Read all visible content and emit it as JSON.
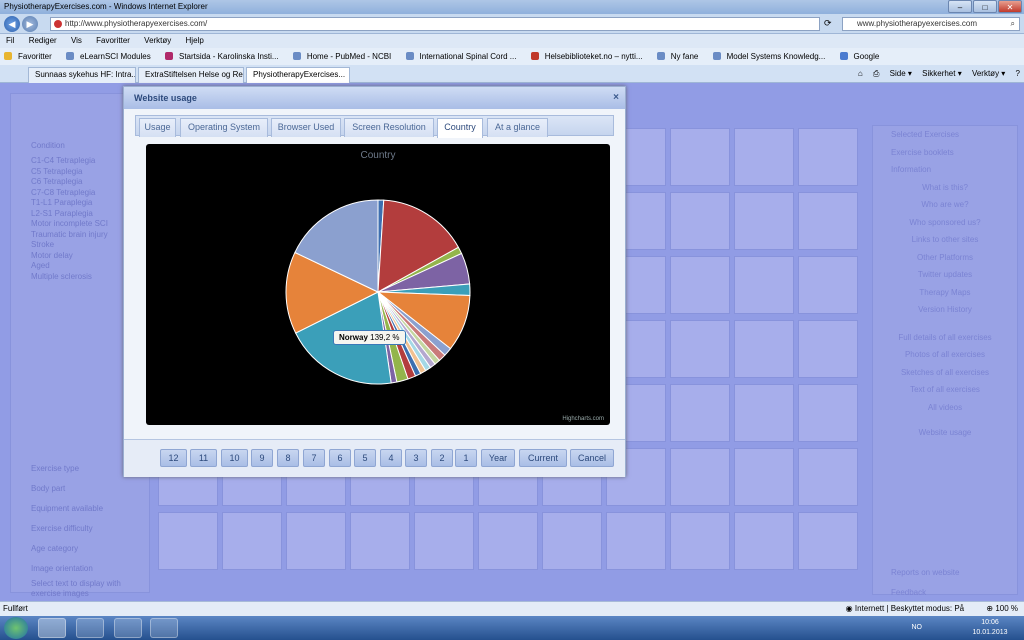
{
  "window": {
    "title": "PhysiotherapyExercises.com - Windows Internet Explorer",
    "address": "http://www.physiotherapyexercises.com/",
    "search_placeholder": "www.physiotherapyexercises.com"
  },
  "menu": [
    "Fil",
    "Rediger",
    "Vis",
    "Favoritter",
    "Verktøy",
    "Hjelp"
  ],
  "favorites": [
    "Favoritter",
    "eLearnSCI Modules",
    "Startsida - Karolinska Insti...",
    "Home - PubMed - NCBI",
    "International Spinal Cord ...",
    "Helsebiblioteket.no – nytti...",
    "Ny fane",
    "Model Systems Knowledg...",
    "Google"
  ],
  "tabs": [
    "Sunnaas sykehus HF: Intra...",
    "ExtraStiftelsen Helse og Re...",
    "PhysiotherapyExercises..."
  ],
  "command_bar": [
    "Side ▾",
    "Sikkerhet ▾",
    "Verktøy ▾"
  ],
  "left_panel": {
    "title": "Condition",
    "items": [
      "C1-C4 Tetraplegia",
      "C5 Tetraplegia",
      "C6 Tetraplegia",
      "C7-C8 Tetraplegia",
      "T1-L1 Paraplegia",
      "L2-S1 Paraplegia",
      "Motor incomplete SCI",
      "Traumatic brain injury",
      "Stroke",
      "Motor delay",
      "Aged",
      "Multiple sclerosis"
    ],
    "sections": [
      "Exercise type",
      "Body part",
      "Equipment available",
      "Exercise difficulty",
      "Age category",
      "Image orientation",
      "Select text to display with exercise images"
    ]
  },
  "right_panel": {
    "sections": [
      "Selected Exercises",
      "Exercise booklets",
      "Information"
    ],
    "links": [
      "What is this?",
      "Who are we?",
      "Who sponsored us?",
      "Links to other sites",
      "Other Platforms",
      "Twitter updates",
      "Therapy Maps",
      "Version History"
    ],
    "links2": [
      "Full details of all exercises",
      "Photos of all exercises",
      "Sketches of all exercises",
      "Text of all exercises",
      "All videos"
    ],
    "usage": "Website usage",
    "bottom": [
      "Reports on website",
      "Feedback"
    ]
  },
  "dialog": {
    "title": "Website usage",
    "close": "×",
    "tabs": [
      "Usage",
      "Operating System",
      "Browser Used",
      "Screen Resolution",
      "Country",
      "At a glance"
    ],
    "active_tab": "Country",
    "buttons": [
      "12",
      "11",
      "10",
      "9",
      "8",
      "7",
      "6",
      "5",
      "4",
      "3",
      "2",
      "1",
      "Year",
      "Current",
      "Cancel"
    ]
  },
  "tooltip": {
    "name": "Norway",
    "value": "139,2 %"
  },
  "credits": "Highcharts.com",
  "chart_data": {
    "type": "pie",
    "title": "Country",
    "slices": [
      {
        "value": 1.0,
        "color": "#3d6fb0"
      },
      {
        "value": 16.0,
        "color": "#b33d3d"
      },
      {
        "value": 1.2,
        "color": "#93b54b"
      },
      {
        "value": 5.5,
        "color": "#7d63a4"
      },
      {
        "value": 2.0,
        "color": "#3b9fb9"
      },
      {
        "value": 10.0,
        "color": "#e6833a"
      },
      {
        "value": 1.5,
        "color": "#8ba0cf"
      },
      {
        "value": 1.3,
        "color": "#c97a7a"
      },
      {
        "value": 1.0,
        "color": "#c4d6a0"
      },
      {
        "value": 1.0,
        "color": "#b4a8cf"
      },
      {
        "value": 1.0,
        "color": "#a4d8e6"
      },
      {
        "value": 1.0,
        "color": "#f0c090"
      },
      {
        "value": 1.0,
        "color": "#3d6fb0"
      },
      {
        "value": 1.4,
        "color": "#b33d3d"
      },
      {
        "value": 2.0,
        "color": "#93b54b"
      },
      {
        "value": 1.0,
        "color": "#7d63a4"
      },
      {
        "value": 20.0,
        "color": "#3b9fb9"
      },
      {
        "value": 14.5,
        "color": "#e6833a"
      },
      {
        "value": 18.0,
        "color": "#8ba0cf"
      }
    ]
  },
  "statusbar": {
    "left": "Fullført",
    "mode": "Internett | Beskyttet modus: På",
    "zoom": "100 %"
  },
  "tray": {
    "lang": "NO",
    "time": "10:06",
    "date": "10.01.2013"
  }
}
